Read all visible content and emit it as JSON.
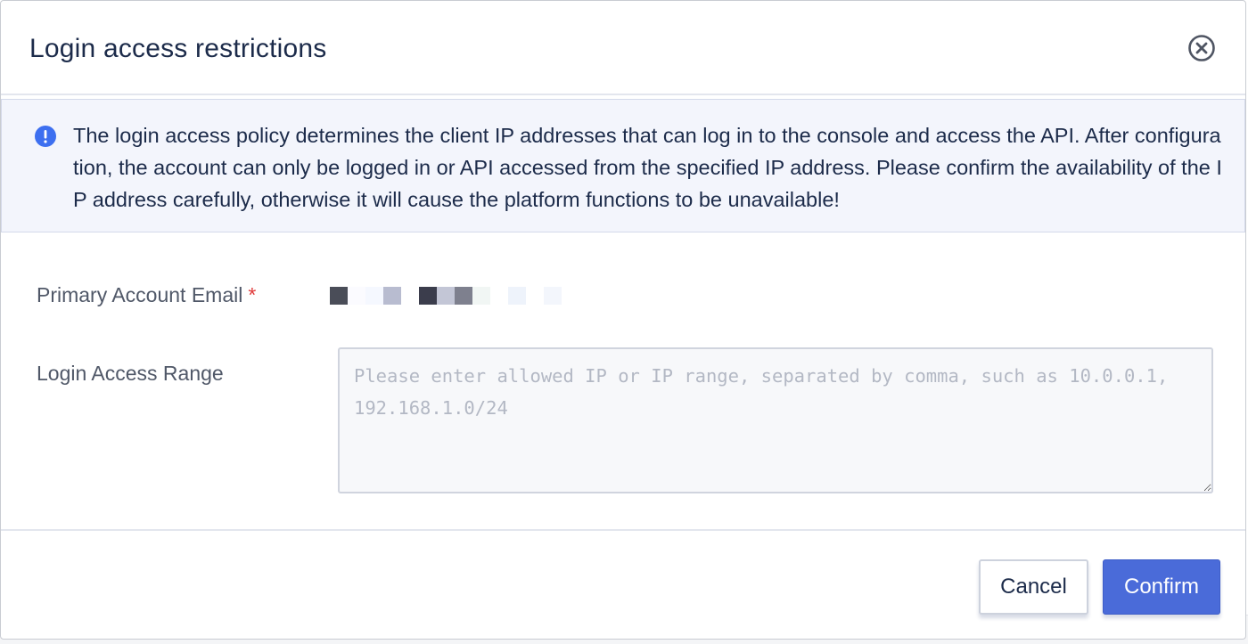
{
  "dialog": {
    "title": "Login access restrictions",
    "close_icon": "circle-x-icon"
  },
  "notice": {
    "icon": "info-exclamation-icon",
    "icon_color": "#3d6ff0",
    "text": "The login access policy determines the client IP addresses that can log in to the console and access the API. After configuration, the account can only be logged in or API accessed from the specified IP address. Please confirm the availability of the IP address carefully, otherwise it will cause the platform functions to be unavailable!"
  },
  "form": {
    "email_label": "Primary Account Email",
    "required_mark": "*",
    "email_value_redacted": true,
    "range_label": "Login Access Range",
    "range_value": "",
    "range_placeholder": "Please enter allowed IP or IP range, separated by comma, such as 10.0.0.1, 192.168.1.0/24"
  },
  "footer": {
    "cancel_label": "Cancel",
    "confirm_label": "Confirm"
  },
  "colors": {
    "primary": "#4a6bd9",
    "title_text": "#1c2b4a",
    "required": "#e03a3a",
    "notice_bg": "#f3f5fc"
  }
}
